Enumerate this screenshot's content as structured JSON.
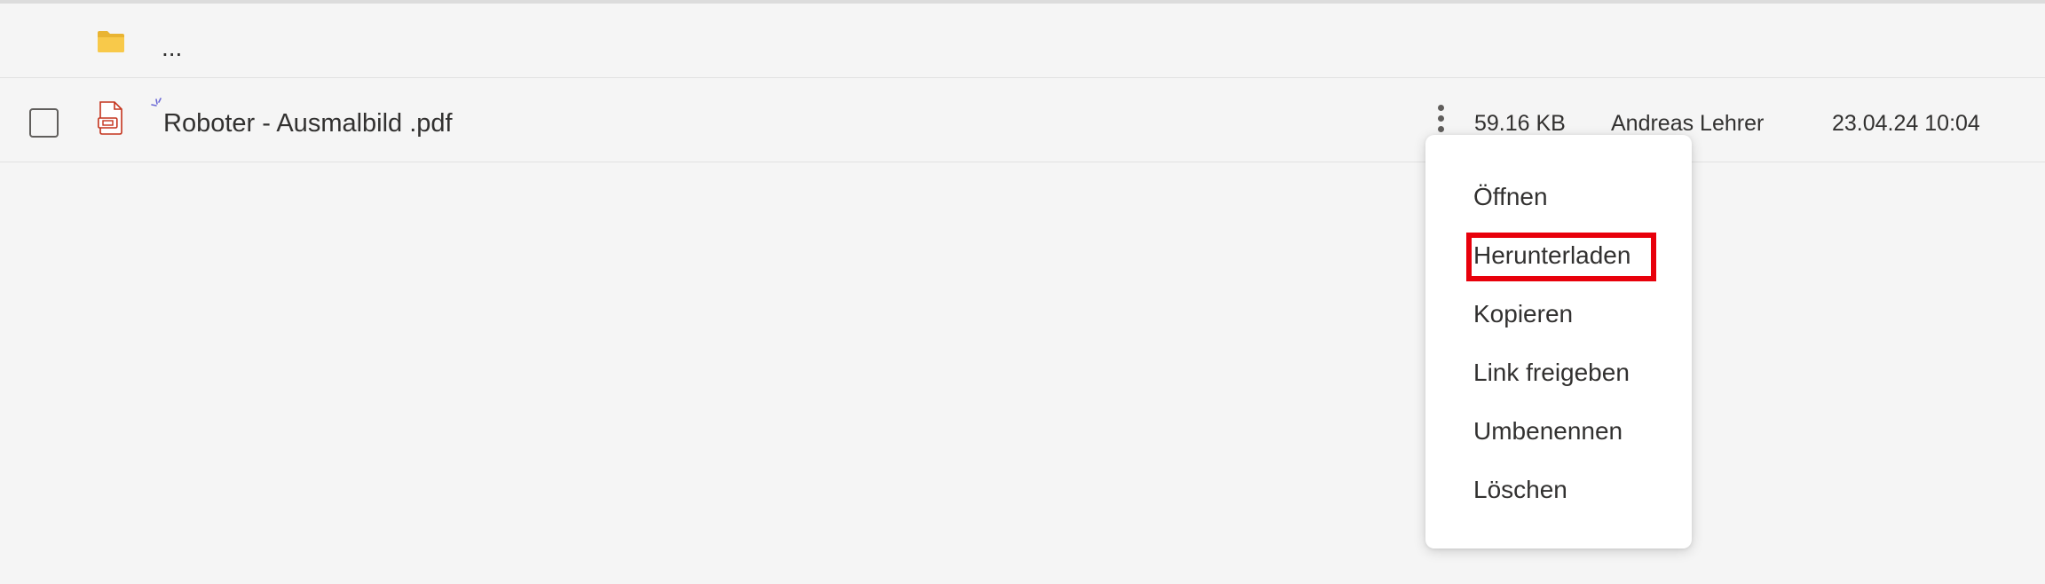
{
  "parent_row": {
    "label": "...",
    "icon": "folder-icon",
    "icon_color": "#f8c94a"
  },
  "file_row": {
    "name": "Roboter - Ausmalbild .pdf",
    "icon": "pdf-file-icon",
    "size": "59.16 KB",
    "owner": "Andreas Lehrer",
    "modified": "23.04.24 10:04",
    "selected": false
  },
  "context_menu": {
    "items": [
      {
        "label": "Öffnen"
      },
      {
        "label": "Herunterladen",
        "highlighted": true
      },
      {
        "label": "Kopieren"
      },
      {
        "label": "Link freigeben"
      },
      {
        "label": "Umbenennen"
      },
      {
        "label": "Löschen"
      }
    ],
    "highlight_color": "#e8000b"
  },
  "colors": {
    "background": "#f5f5f5",
    "text": "#323130",
    "pdf_accent": "#c4341d"
  }
}
